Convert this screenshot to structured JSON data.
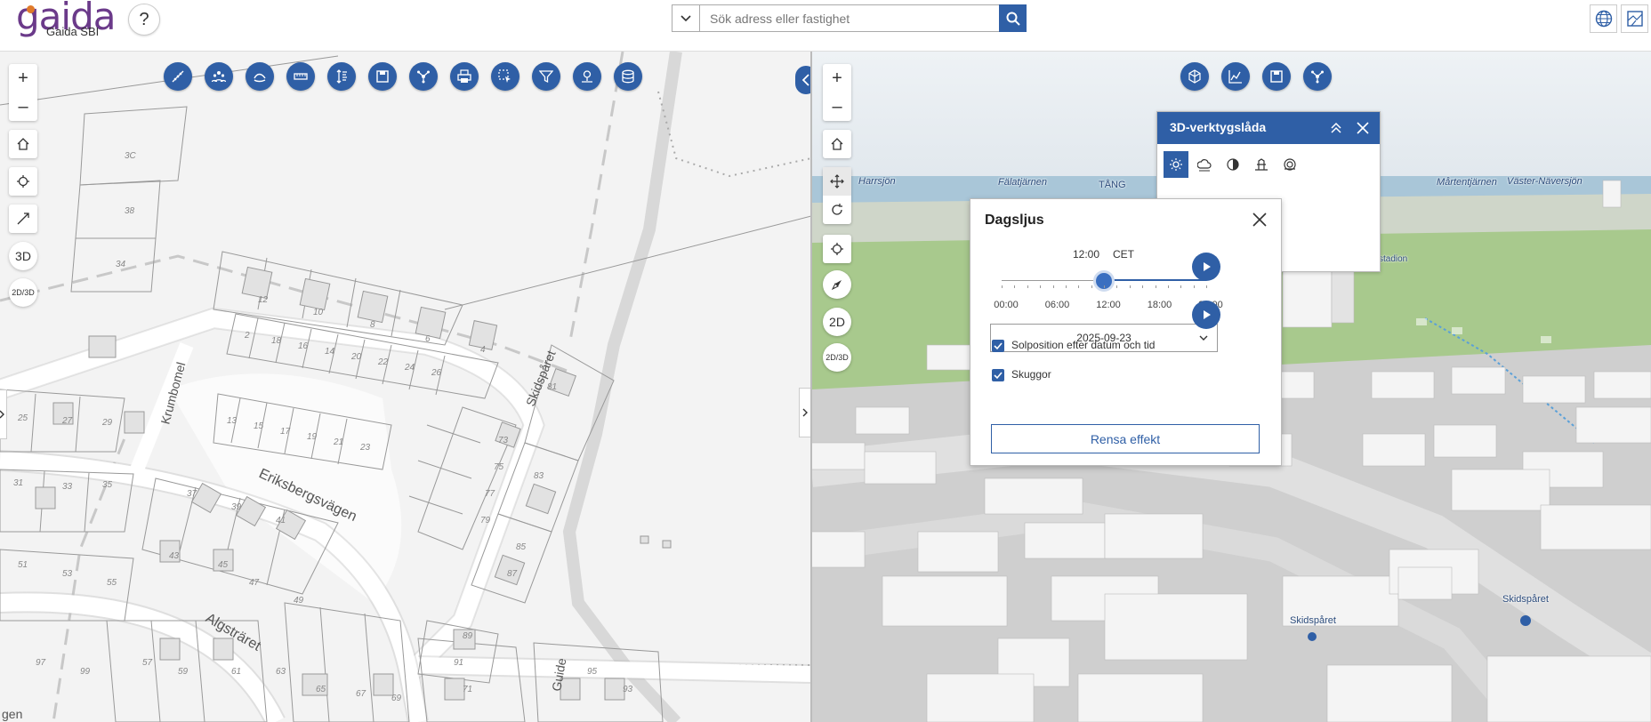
{
  "header": {
    "logo_word": "gaida",
    "logo_sub": "Gaida SBI",
    "help_label": "?",
    "search": {
      "placeholder": "Sök adress eller fastighet",
      "value": ""
    }
  },
  "map2d": {
    "zoom_in": "+",
    "zoom_out": "–",
    "btn_3d": "3D",
    "btn_2d3d": "2D/3D",
    "street_labels": [
      {
        "text": "Krumbomel"
      },
      {
        "text": "Eriksbergsvägen"
      },
      {
        "text": "Algsträret"
      },
      {
        "text": "Skidspåret"
      },
      {
        "text": "Guide"
      },
      {
        "text": "gen"
      }
    ],
    "parcel_numbers": [
      "3C",
      "38",
      "34",
      "12",
      "10",
      "8",
      "6",
      "4",
      "2",
      "18",
      "16",
      "14",
      "20",
      "22",
      "24",
      "26",
      "13",
      "15",
      "17",
      "19",
      "21",
      "23",
      "25",
      "27",
      "29",
      "31",
      "33",
      "35",
      "37",
      "39",
      "41",
      "43",
      "45",
      "47",
      "49",
      "51",
      "53",
      "55",
      "57",
      "59",
      "61",
      "63",
      "65",
      "67",
      "69",
      "71",
      "73",
      "75",
      "77",
      "79",
      "81",
      "83",
      "85",
      "87",
      "89",
      "91",
      "93",
      "95",
      "97",
      "99"
    ]
  },
  "map3d": {
    "zoom_in": "+",
    "zoom_out": "–",
    "btn_2d": "2D",
    "btn_2d3d": "2D/3D",
    "place_names": [
      "Harrsjön",
      "Fälatjärnen",
      "TÅNG",
      "Mårtentjärnen",
      "Väster-Näversjön",
      "stadion",
      "Skidspåret",
      "Skidspåret"
    ]
  },
  "toolbox": {
    "title": "3D-verktygslåda",
    "tools": [
      "sun-icon",
      "weather-icon",
      "shadow-icon",
      "elevation-icon",
      "viewshed-icon"
    ]
  },
  "daylight": {
    "title": "Dagsljus",
    "time": "12:00",
    "tz": "CET",
    "slider_value_fraction": 0.5,
    "ticks": [
      "00:00",
      "06:00",
      "12:00",
      "18:00",
      "24:00"
    ],
    "date": "2025-09-23",
    "checkbox_sun": "Solposition efter datum och tid",
    "checkbox_shadows": "Skuggor",
    "clear_button": "Rensa effekt"
  },
  "colors": {
    "accent": "#2f5fa6",
    "brand": "#6b3a8a",
    "brand_dot": "#e07a2a"
  }
}
